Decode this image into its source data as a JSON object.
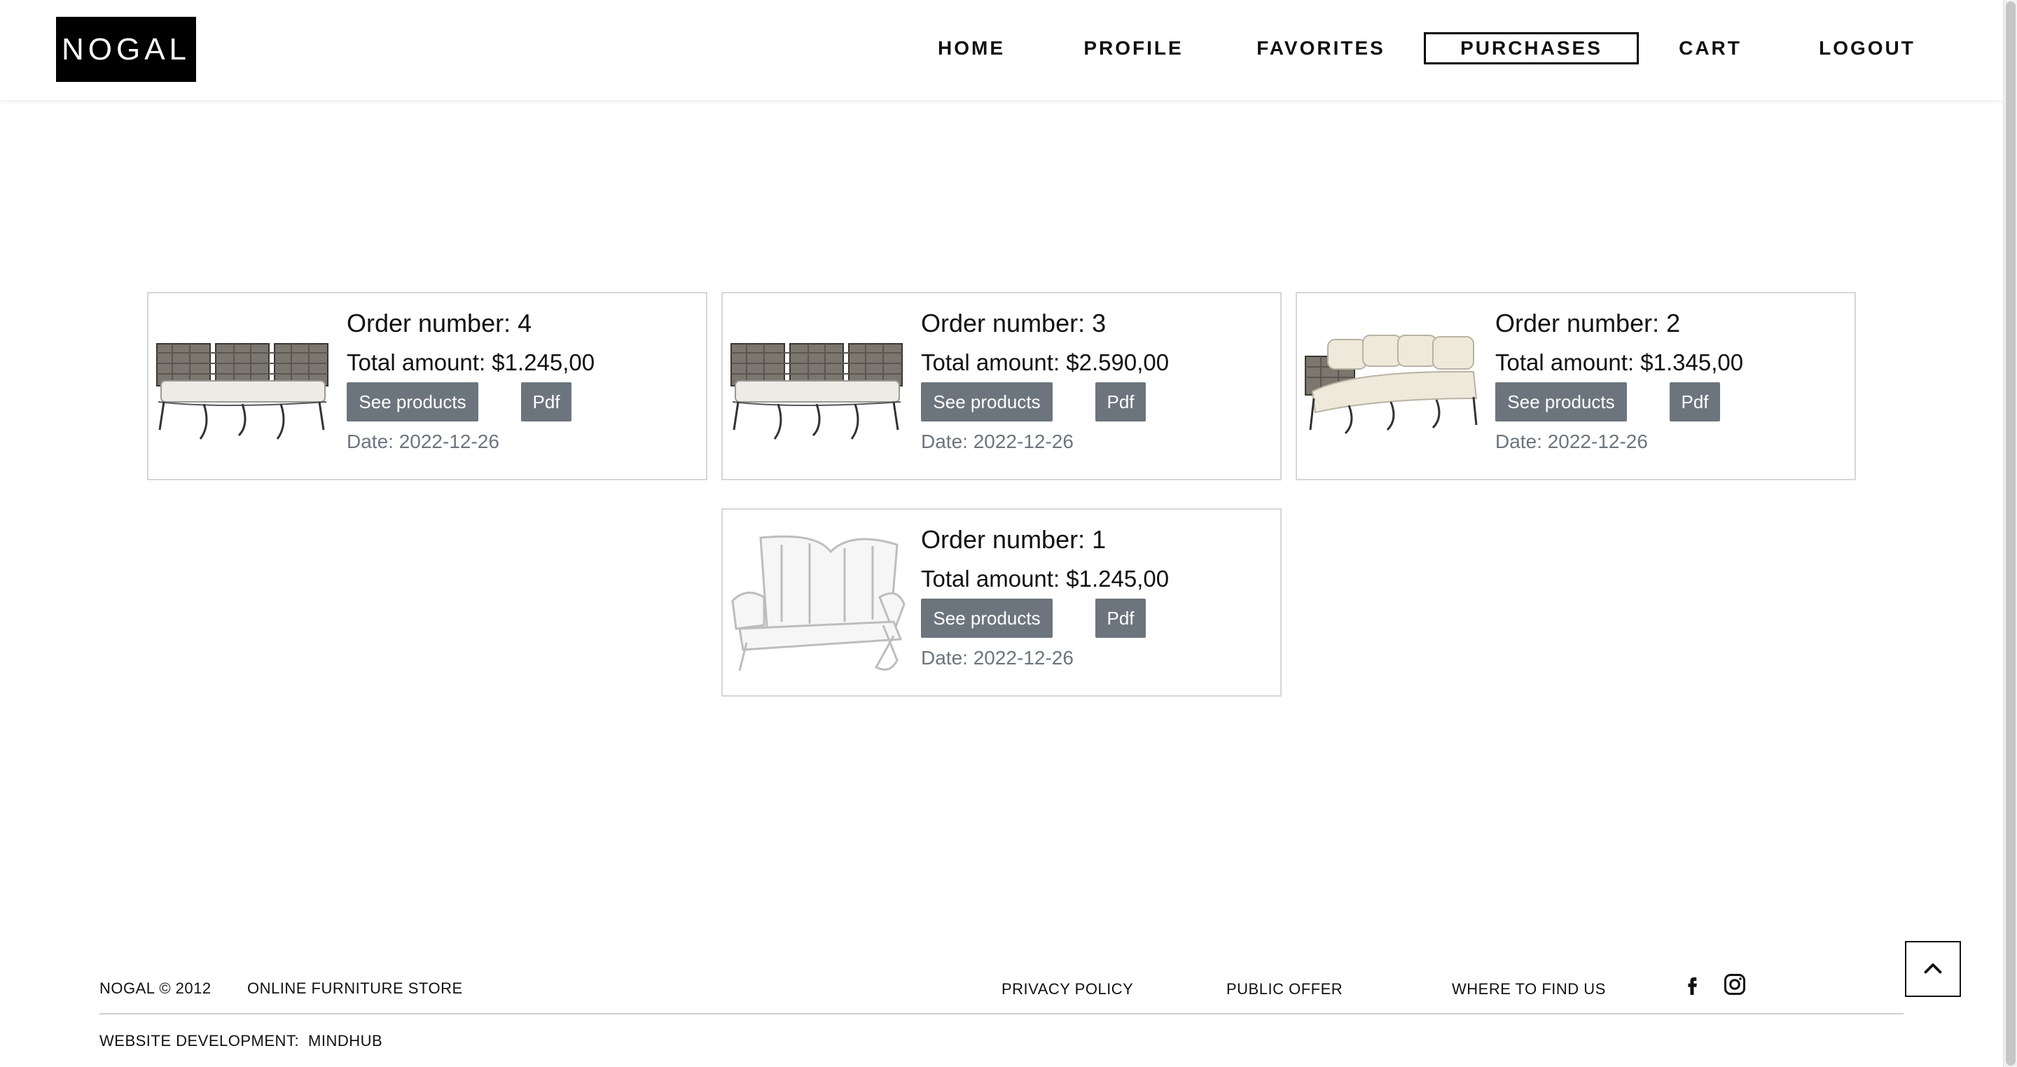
{
  "brand": {
    "logo_text": "NOGAL"
  },
  "nav": {
    "items": [
      {
        "label": "HOME"
      },
      {
        "label": "PROFILE"
      },
      {
        "label": "FAVORITES"
      },
      {
        "label": "PURCHASES",
        "active": true
      },
      {
        "label": "CART"
      },
      {
        "label": "LOGOUT"
      }
    ]
  },
  "orders": [
    {
      "title": "Order number: 4",
      "total": "Total amount: $1.245,00",
      "see_label": "See products",
      "pdf_label": "Pdf",
      "date": "Date: 2022-12-26",
      "image": "dark-wicker-sofa"
    },
    {
      "title": "Order number: 3",
      "total": "Total amount: $2.590,00",
      "see_label": "See products",
      "pdf_label": "Pdf",
      "date": "Date: 2022-12-26",
      "image": "dark-wicker-sofa"
    },
    {
      "title": "Order number: 2",
      "total": "Total amount: $1.345,00",
      "see_label": "See products",
      "pdf_label": "Pdf",
      "date": "Date: 2022-12-26",
      "image": "corner-sofa"
    },
    {
      "title": "Order number: 1",
      "total": "Total amount: $1.245,00",
      "see_label": "See products",
      "pdf_label": "Pdf",
      "date": "Date: 2022-12-26",
      "image": "white-wire-loveseat"
    }
  ],
  "footer": {
    "copyright": "NOGAL © 2012",
    "tagline": "ONLINE FURNITURE STORE",
    "links": [
      "PRIVACY POLICY",
      "PUBLIC OFFER",
      "WHERE TO FIND US"
    ],
    "dev_label": "WEBSITE DEVELOPMENT:",
    "dev_name": "MINDHUB",
    "social_icons": [
      "facebook-icon",
      "instagram-icon"
    ],
    "to_top_icon": "chevron-up-icon"
  },
  "colors": {
    "button": "#6c757d",
    "logo_bg": "#000000",
    "date_text": "#6c757d"
  }
}
